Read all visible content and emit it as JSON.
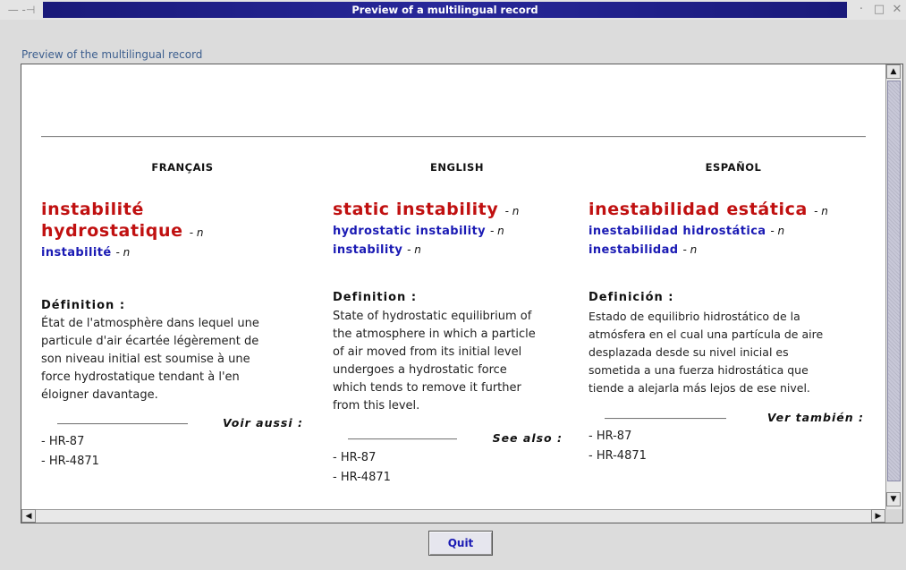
{
  "window": {
    "title": "Preview of a multilingual record",
    "left_controls": "— -⊣",
    "minimize_glyph": "·",
    "maximize_glyph": "□",
    "close_glyph": "✕"
  },
  "panel_label": "Preview of the multilingual record",
  "columns": [
    {
      "language": "FRANÇAIS",
      "main_term_lines": [
        "instabilité",
        "hydrostatique"
      ],
      "main_pos": "- n",
      "synonyms": [
        {
          "term": "instabilité",
          "pos": "- n"
        }
      ],
      "definition_heading": "Définition :",
      "definition_lines": [
        "État de l'atmosphère dans lequel une",
        "particule d'air écartée légèrement de",
        "son niveau initial est soumise à une",
        "force hydrostatique tendant à l'en",
        "éloigner davantage."
      ],
      "see_also_label": "Voir aussi :",
      "references": [
        "- HR-87",
        "- HR-4871"
      ]
    },
    {
      "language": "ENGLISH",
      "main_term_lines": [
        "static instability"
      ],
      "main_pos": "- n",
      "synonyms": [
        {
          "term": "hydrostatic instability",
          "pos": "- n"
        },
        {
          "term": "instability",
          "pos": "- n"
        }
      ],
      "definition_heading": "Definition :",
      "definition_lines": [
        "State of hydrostatic equilibrium of",
        "the atmosphere in which a particle",
        "of air moved from its initial level",
        "undergoes a hydrostatic force",
        "which tends to remove it further",
        "from this level."
      ],
      "see_also_label": "See also :",
      "references": [
        "- HR-87",
        "- HR-4871"
      ]
    },
    {
      "language": "ESPAÑOL",
      "main_term_lines": [
        "inestabilidad estática"
      ],
      "main_pos": "- n",
      "synonyms": [
        {
          "term": "inestabilidad hidrostática",
          "pos": "- n"
        },
        {
          "term": "inestabilidad",
          "pos": "- n"
        }
      ],
      "definition_heading": "Definición :",
      "definition_lines": [
        "Estado de equilibrio hidrostático de la",
        "atmósfera en el cual una partícula de aire",
        "desplazada desde su nivel inicial es",
        "sometida a una fuerza hidrostática que",
        "tiende a alejarla más lejos de ese nivel."
      ],
      "see_also_label": "Ver también :",
      "references": [
        "- HR-87",
        "- HR-4871"
      ]
    }
  ],
  "scroll": {
    "up_glyph": "▲",
    "down_glyph": "▼",
    "left_glyph": "◀",
    "right_glyph": "▶"
  },
  "quit_label": "Quit",
  "colors": {
    "title_bar": "#1a1a7a",
    "main_term": "#c01010",
    "synonym": "#1a1ab4",
    "panel_label": "#3c5e8e"
  }
}
